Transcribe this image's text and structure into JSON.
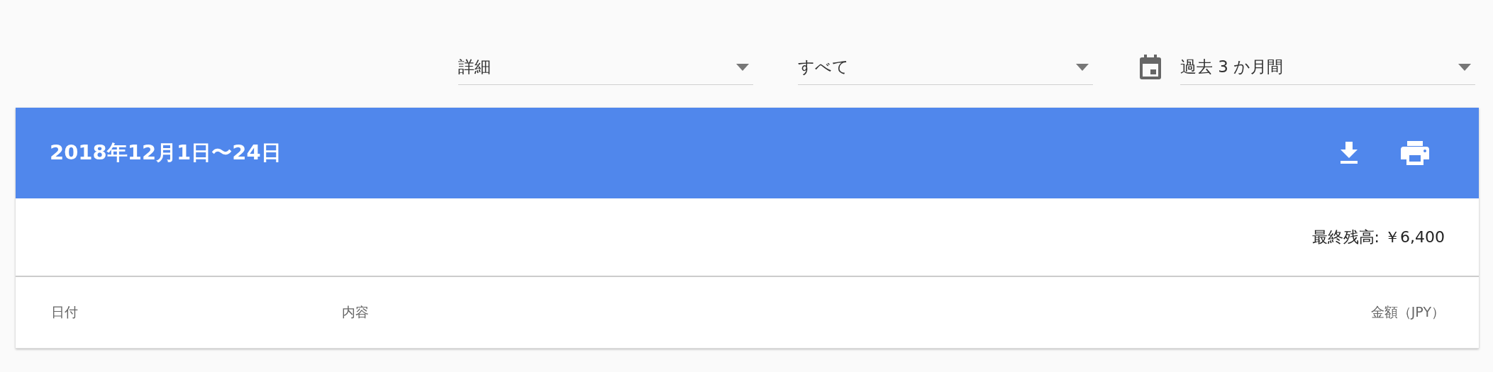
{
  "filters": [
    {
      "kind": "select",
      "value": "詳細"
    },
    {
      "kind": "select",
      "value": "すべて"
    },
    {
      "kind": "date",
      "value": "過去 3 か月間"
    }
  ],
  "statement": {
    "title": "2018年12月1日〜24日",
    "balance": "最終残高: ￥6,400",
    "columns": [
      "日付",
      "内容",
      "金額（JPY）"
    ]
  }
}
